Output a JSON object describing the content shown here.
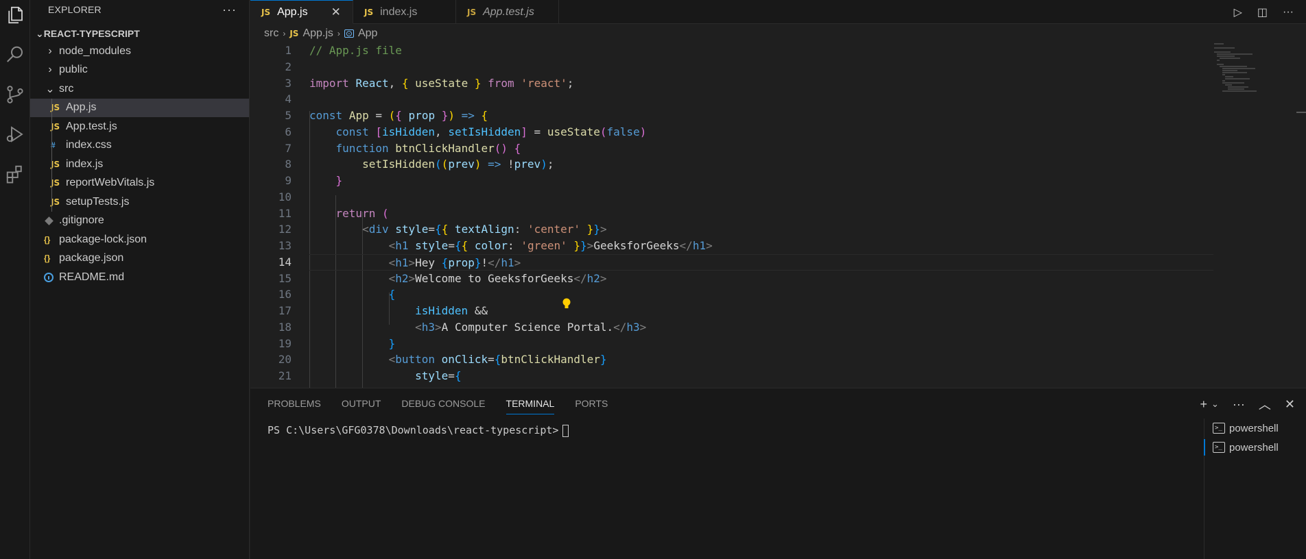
{
  "explorer": {
    "title": "EXPLORER",
    "more": "···",
    "project": "REACT-TYPESCRIPT",
    "items": [
      {
        "label": "node_modules",
        "type": "folder"
      },
      {
        "label": "public",
        "type": "folder"
      },
      {
        "label": "src",
        "type": "folder-open"
      },
      {
        "label": "App.js",
        "type": "js",
        "selected": true
      },
      {
        "label": "App.test.js",
        "type": "js"
      },
      {
        "label": "index.css",
        "type": "css"
      },
      {
        "label": "index.js",
        "type": "js"
      },
      {
        "label": "reportWebVitals.js",
        "type": "js"
      },
      {
        "label": "setupTests.js",
        "type": "js"
      },
      {
        "label": ".gitignore",
        "type": "git"
      },
      {
        "label": "package-lock.json",
        "type": "json"
      },
      {
        "label": "package.json",
        "type": "json"
      },
      {
        "label": "README.md",
        "type": "info"
      }
    ],
    "js_badge": "JS",
    "css_badge": "#",
    "json_badge": "{}"
  },
  "tabs": [
    {
      "label": "App.js",
      "active": true,
      "close": "✕"
    },
    {
      "label": "index.js",
      "active": false
    },
    {
      "label": "App.test.js",
      "active": false,
      "italic": true
    }
  ],
  "breadcrumb": {
    "folder": "src",
    "file": "App.js",
    "symbol": "App"
  },
  "editor": {
    "active_line": 14,
    "line_numbers": [
      "1",
      "2",
      "3",
      "4",
      "5",
      "6",
      "7",
      "8",
      "9",
      "10",
      "11",
      "12",
      "13",
      "14",
      "15",
      "16",
      "17",
      "18",
      "19",
      "20",
      "21"
    ]
  },
  "panel": {
    "tabs": [
      "PROBLEMS",
      "OUTPUT",
      "DEBUG CONSOLE",
      "TERMINAL",
      "PORTS"
    ],
    "active_tab": "TERMINAL",
    "terminal_prompt": "PS C:\\Users\\GFG0378\\Downloads\\react-typescript>",
    "terminals": [
      "powershell",
      "powershell"
    ]
  },
  "colors": {
    "accent": "#0078d4",
    "js_icon": "#e8c34a",
    "css_icon": "#4a9fe0"
  }
}
